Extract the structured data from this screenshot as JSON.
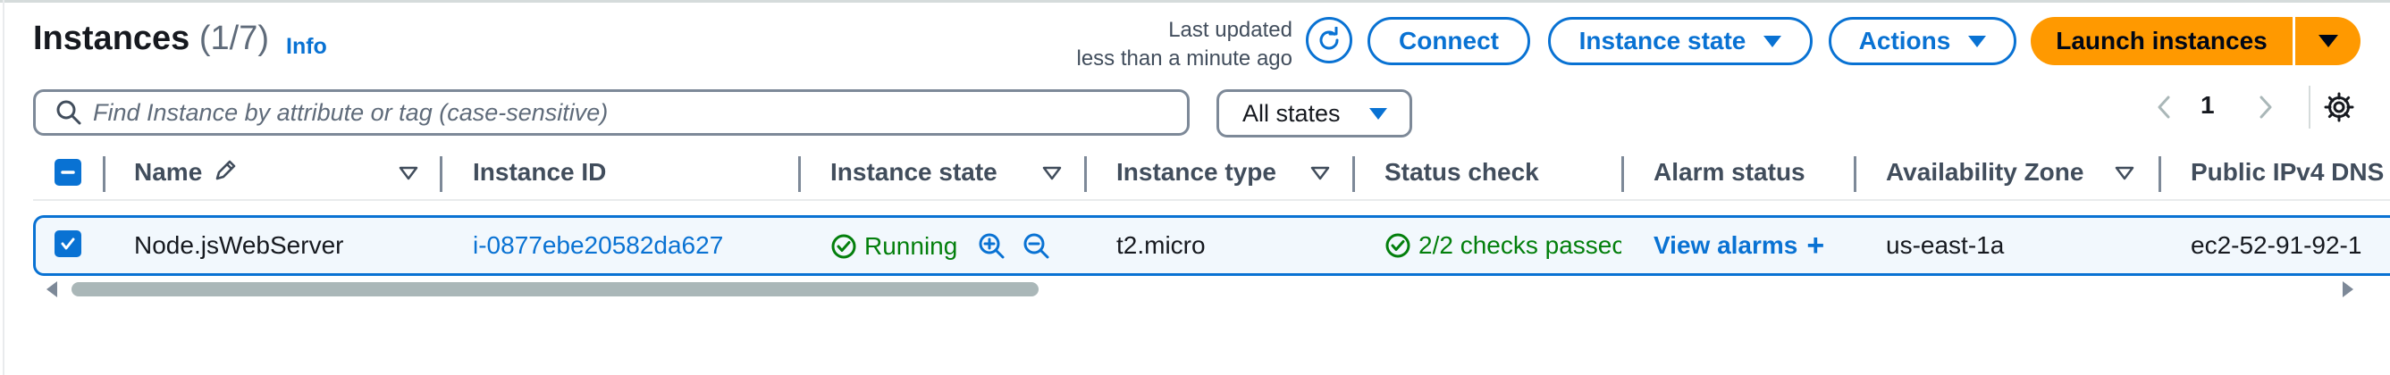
{
  "header": {
    "title": "Instances",
    "count": "(1/7)",
    "info": "Info",
    "last_updated_line1": "Last updated",
    "last_updated_line2": "less than a minute ago"
  },
  "buttons": {
    "connect": "Connect",
    "instance_state": "Instance state",
    "actions": "Actions",
    "launch": "Launch instances"
  },
  "search": {
    "placeholder": "Find Instance by attribute or tag (case-sensitive)"
  },
  "filter": {
    "selected": "All states"
  },
  "pagination": {
    "current_page": "1"
  },
  "table": {
    "columns": [
      "Name",
      "Instance ID",
      "Instance state",
      "Instance type",
      "Status check",
      "Alarm status",
      "Availability Zone",
      "Public IPv4 DNS"
    ],
    "rows": [
      {
        "name": "Node.jsWebServer",
        "instance_id": "i-0877ebe20582da627",
        "state": "Running",
        "type": "t2.micro",
        "status_check": "2/2 checks passec",
        "alarm": "View alarms",
        "alarm_add": "+",
        "zone": "us-east-1a",
        "dns": "ec2-52-91-92-1"
      }
    ]
  },
  "colors": {
    "accent": "#0972d3",
    "launch": "#ff9900",
    "success": "#037f0c"
  },
  "icons": [
    "refresh-icon",
    "caret-down-icon",
    "search-icon",
    "chevron-left-icon",
    "chevron-right-icon",
    "gear-icon",
    "edit-icon",
    "sort-icon",
    "check-circle-icon",
    "zoom-in-icon",
    "zoom-out-icon",
    "plus-icon",
    "checkbox-check-icon"
  ]
}
